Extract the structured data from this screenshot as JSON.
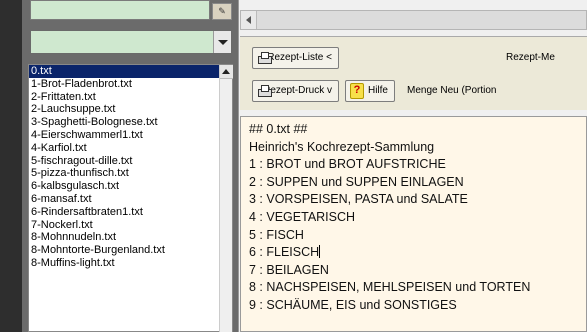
{
  "toolbar": {
    "recipe_list_label": "Rezept-Liste  <",
    "recipe_print_label": "Rezept-Druck  v",
    "help_label": "Hilfe",
    "help_glyph": "?",
    "rezept_me_label": "Rezept-Me",
    "menge_label": "Menge Neu (Portion"
  },
  "file_list": {
    "items": [
      "0.txt",
      "1-Brot-Fladenbrot.txt",
      "2-Frittaten.txt",
      "2-Lauchsuppe.txt",
      "3-Spaghetti-Bolognese.txt",
      "4-Eierschwammerl1.txt",
      "4-Karfiol.txt",
      "5-fischragout-dille.txt",
      "5-pizza-thunfisch.txt",
      "6-kalbsgulasch.txt",
      "6-mansaf.txt",
      "6-Rindersaftbraten1.txt",
      "7-Nockerl.txt",
      "8-Mohnnudeln.txt",
      "8-Mohntorte-Burgenland.txt",
      "8-Muffins-light.txt"
    ],
    "selected_index": 0
  },
  "editor": {
    "lines": [
      "## 0.txt ##",
      "Heinrich's Kochrezept-Sammlung",
      "1 : BROT und BROT AUFSTRICHE",
      "2 : SUPPEN und  SUPPEN EINLAGEN",
      "3 : VORSPEISEN, PASTA und SALATE",
      "4 : VEGETARISCH",
      "5 : FISCH",
      "6 : FLEISCH",
      "7 : BEILAGEN",
      "8 : NACHSPEISEN, MEHLSPEISEN und TORTEN",
      "9 : SCHÄUME, EIS und SONSTIGES"
    ],
    "caret_line": 7
  },
  "colors": {
    "selection": "#0a246a",
    "editor_bg": "#fff7e8",
    "field_bg": "#cfe8cf"
  },
  "icons": [
    "printer-icon",
    "help-icon",
    "dropdown-arrow-icon",
    "scroll-up-icon",
    "scroll-left-icon"
  ]
}
